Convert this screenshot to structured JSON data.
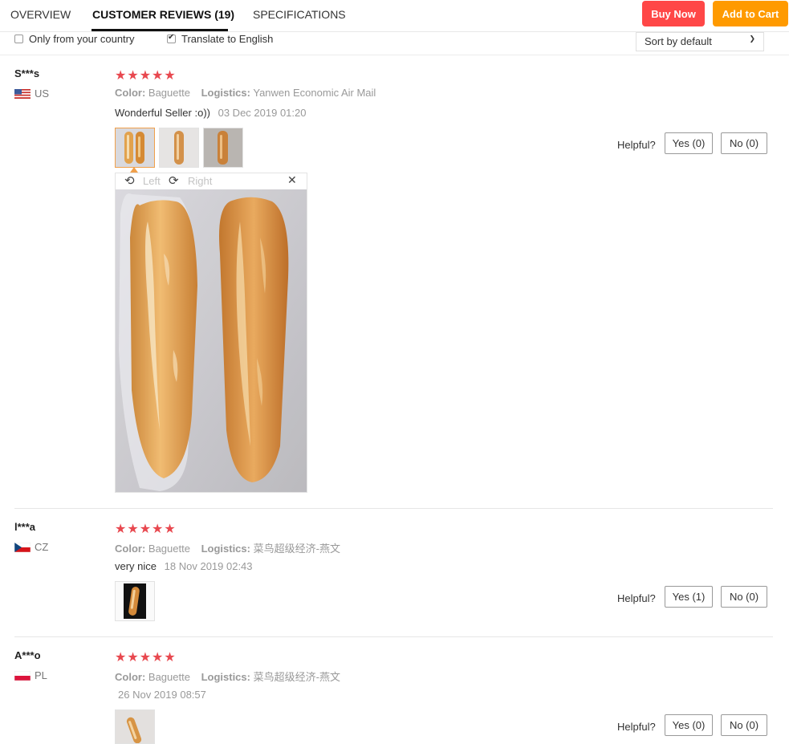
{
  "tabs": [
    {
      "label": "OVERVIEW"
    },
    {
      "label": "CUSTOMER REVIEWS (19)"
    },
    {
      "label": "SPECIFICATIONS"
    }
  ],
  "actions": {
    "buy_now": "Buy Now",
    "add_to_cart": "Add to Cart"
  },
  "filters": {
    "own_country": {
      "label": "Only from your country",
      "checked": false
    },
    "translate": {
      "label": "Translate to English",
      "checked": true
    },
    "sort": {
      "value": "Sort by default"
    }
  },
  "viewer": {
    "left_label": "Left",
    "right_label": "Right"
  },
  "labels": {
    "color_key": "Color:",
    "logistics_key": "Logistics:",
    "helpful": "Helpful?"
  },
  "reviews": [
    {
      "user": "S***s",
      "country": "US",
      "rating": "★★★★★",
      "color": "Baguette",
      "logistics": "Yanwen Economic Air Mail",
      "text": "Wonderful Seller :o))",
      "date": "03 Dec 2019 01:20",
      "yes": "Yes (0)",
      "no": "No (0)"
    },
    {
      "user": "l***a",
      "country": "CZ",
      "rating": "★★★★★",
      "color": "Baguette",
      "logistics": "菜鸟超级经济-燕文",
      "text": "very nice",
      "date": "18 Nov 2019 02:43",
      "yes": "Yes (1)",
      "no": "No (0)"
    },
    {
      "user": "A***o",
      "country": "PL",
      "rating": "★★★★★",
      "color": "Baguette",
      "logistics": "菜鸟超级经济-燕文",
      "text": "",
      "date": "26 Nov 2019 08:57",
      "yes": "Yes (0)",
      "no": "No (0)"
    }
  ],
  "colors": {
    "buy_now": "#ff4747",
    "add_to_cart": "#ff9a00",
    "stars": "#e8484f"
  }
}
